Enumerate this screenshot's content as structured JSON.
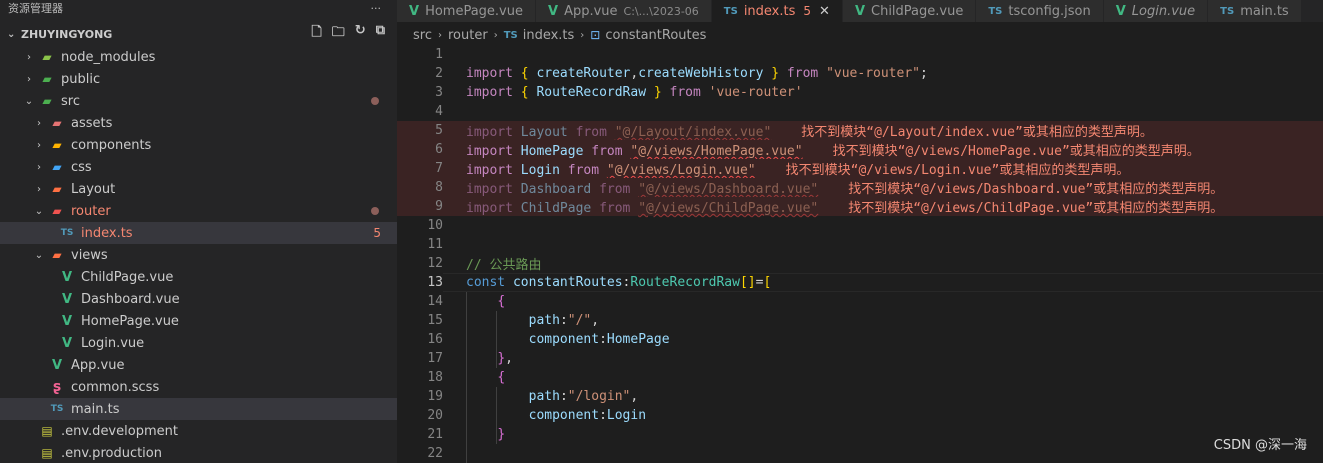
{
  "explorer": {
    "title": "资源管理器",
    "more": "···",
    "root_label": "ZHUYINGYONG",
    "items": [
      {
        "label": "node_modules",
        "icon": "folder-node-icon",
        "color": "#8bc34a",
        "chev": "›",
        "indent": 0
      },
      {
        "label": "public",
        "icon": "folder-public-icon",
        "color": "#4caf50",
        "chev": "›",
        "indent": 0
      },
      {
        "label": "src",
        "icon": "folder-src-icon",
        "color": "#4caf50",
        "chev": "⌄",
        "indent": 0
      },
      {
        "label": "assets",
        "icon": "folder-assets-icon",
        "color": "#e57373",
        "chev": "›",
        "indent": 1
      },
      {
        "label": "components",
        "icon": "folder-components-icon",
        "color": "#ffb300",
        "chev": "›",
        "indent": 1
      },
      {
        "label": "css",
        "icon": "folder-css-icon",
        "color": "#42a5f5",
        "chev": "›",
        "indent": 1
      },
      {
        "label": "Layout",
        "icon": "folder-layout-icon",
        "color": "#ff7043",
        "chev": "›",
        "indent": 1
      },
      {
        "label": "router",
        "icon": "folder-router-icon",
        "color": "#ef5350",
        "chev": "⌄",
        "indent": 1
      },
      {
        "label": "index.ts",
        "icon": "typescript-icon",
        "color": "#519aba",
        "chev": "",
        "indent": 2
      },
      {
        "label": "views",
        "icon": "folder-views-icon",
        "color": "#ff7043",
        "chev": "⌄",
        "indent": 1
      },
      {
        "label": "ChildPage.vue",
        "icon": "vue-icon",
        "color": "#41b883",
        "chev": "",
        "indent": 2
      },
      {
        "label": "Dashboard.vue",
        "icon": "vue-icon",
        "color": "#41b883",
        "chev": "",
        "indent": 2
      },
      {
        "label": "HomePage.vue",
        "icon": "vue-icon",
        "color": "#41b883",
        "chev": "",
        "indent": 2
      },
      {
        "label": "Login.vue",
        "icon": "vue-icon",
        "color": "#41b883",
        "chev": "",
        "indent": 2
      },
      {
        "label": "App.vue",
        "icon": "vue-icon",
        "color": "#41b883",
        "chev": "",
        "indent": 1
      },
      {
        "label": "common.scss",
        "icon": "sass-icon",
        "color": "#f06292",
        "chev": "",
        "indent": 1
      },
      {
        "label": "main.ts",
        "icon": "typescript-icon",
        "color": "#519aba",
        "chev": "",
        "indent": 1
      },
      {
        "label": ".env.development",
        "icon": "env-file-icon",
        "color": "#cbcb41",
        "chev": "",
        "indent": 0
      },
      {
        "label": ".env.production",
        "icon": "env-file-icon",
        "color": "#cbcb41",
        "chev": "",
        "indent": 0
      }
    ],
    "index_badge": "5"
  },
  "tabs": [
    {
      "label": "HomePage.vue",
      "icon_text": "V",
      "icon": "vue-icon",
      "hint": "",
      "num": ""
    },
    {
      "label": "App.vue",
      "icon_text": "V",
      "icon": "vue-icon",
      "hint": "C:\\...\\2023-06",
      "num": ""
    },
    {
      "label": "index.ts",
      "icon_text": "TS",
      "icon": "typescript-icon",
      "hint": "",
      "num": "5"
    },
    {
      "label": "ChildPage.vue",
      "icon_text": "V",
      "icon": "vue-icon",
      "hint": "",
      "num": ""
    },
    {
      "label": "tsconfig.json",
      "icon_text": "TS",
      "icon": "typescript-icon",
      "hint": "",
      "num": ""
    },
    {
      "label": "Login.vue",
      "icon_text": "V",
      "icon": "vue-icon",
      "hint": "",
      "num": ""
    },
    {
      "label": "main.ts",
      "icon_text": "TS",
      "icon": "typescript-icon",
      "hint": "",
      "num": ""
    }
  ],
  "breadcrumb": {
    "src": "src",
    "router": "router",
    "file_icon": "TS",
    "file": "index.ts",
    "symbol": "constantRoutes"
  },
  "editor": {
    "current_line": 13,
    "lines": [
      {
        "n": "1"
      },
      {
        "n": "2",
        "tokens": [
          [
            "kw",
            "import"
          ],
          [
            "pl",
            " "
          ],
          [
            "br3",
            "{"
          ],
          [
            "pl",
            " "
          ],
          [
            "id",
            "createRouter"
          ],
          [
            "pl",
            ","
          ],
          [
            "id",
            "createWebHistory"
          ],
          [
            "pl",
            " "
          ],
          [
            "br3",
            "}"
          ],
          [
            "pl",
            " "
          ],
          [
            "kw",
            "from"
          ],
          [
            "pl",
            " "
          ],
          [
            "str",
            "\"vue-router\""
          ],
          [
            "pl",
            ";"
          ]
        ]
      },
      {
        "n": "3",
        "tokens": [
          [
            "kw",
            "import"
          ],
          [
            "pl",
            " "
          ],
          [
            "br3",
            "{"
          ],
          [
            "pl",
            " "
          ],
          [
            "id",
            "RouteRecordRaw"
          ],
          [
            "pl",
            " "
          ],
          [
            "br3",
            "}"
          ],
          [
            "pl",
            " "
          ],
          [
            "kw",
            "from"
          ],
          [
            "pl",
            " "
          ],
          [
            "str",
            "'vue-router'"
          ]
        ]
      },
      {
        "n": "4"
      },
      {
        "n": "5",
        "err": true,
        "dim": true,
        "tokens": [
          [
            "kw",
            "import"
          ],
          [
            "pl",
            " "
          ],
          [
            "id",
            "Layout"
          ],
          [
            "pl",
            " "
          ],
          [
            "kw",
            "from"
          ],
          [
            "pl",
            " "
          ],
          [
            "sq",
            "\"@/Layout/index.vue\""
          ]
        ],
        "msg": "找不到模块“@/Layout/index.vue”或其相应的类型声明。"
      },
      {
        "n": "6",
        "err": true,
        "tokens": [
          [
            "kw",
            "import"
          ],
          [
            "pl",
            " "
          ],
          [
            "id",
            "HomePage"
          ],
          [
            "pl",
            " "
          ],
          [
            "kw",
            "from"
          ],
          [
            "pl",
            " "
          ],
          [
            "sq",
            "\"@/views/HomePage.vue\""
          ]
        ],
        "msg": "找不到模块“@/views/HomePage.vue”或其相应的类型声明。"
      },
      {
        "n": "7",
        "err": true,
        "tokens": [
          [
            "kw",
            "import"
          ],
          [
            "pl",
            " "
          ],
          [
            "id",
            "Login"
          ],
          [
            "pl",
            " "
          ],
          [
            "kw",
            "from"
          ],
          [
            "pl",
            " "
          ],
          [
            "sq",
            "\"@/views/Login.vue\""
          ]
        ],
        "msg": "找不到模块“@/views/Login.vue”或其相应的类型声明。"
      },
      {
        "n": "8",
        "err": true,
        "dim": true,
        "tokens": [
          [
            "kw",
            "import"
          ],
          [
            "pl",
            " "
          ],
          [
            "id",
            "Dashboard"
          ],
          [
            "pl",
            " "
          ],
          [
            "kw",
            "from"
          ],
          [
            "pl",
            " "
          ],
          [
            "sq",
            "\"@/views/Dashboard.vue\""
          ]
        ],
        "msg": "找不到模块“@/views/Dashboard.vue”或其相应的类型声明。"
      },
      {
        "n": "9",
        "err": true,
        "dim": true,
        "tokens": [
          [
            "kw",
            "import"
          ],
          [
            "pl",
            " "
          ],
          [
            "id",
            "ChildPage"
          ],
          [
            "pl",
            " "
          ],
          [
            "kw",
            "from"
          ],
          [
            "pl",
            " "
          ],
          [
            "sq",
            "\"@/views/ChildPage.vue\""
          ]
        ],
        "msg": "找不到模块“@/views/ChildPage.vue”或其相应的类型声明。"
      },
      {
        "n": "10"
      },
      {
        "n": "11"
      },
      {
        "n": "12",
        "tokens": [
          [
            "cm",
            "// 公共路由"
          ]
        ]
      },
      {
        "n": "13",
        "tokens": [
          [
            "kw2",
            "const"
          ],
          [
            "pl",
            " "
          ],
          [
            "id",
            "constantRoutes"
          ],
          [
            "pl",
            ":"
          ],
          [
            "ty",
            "RouteRecordRaw"
          ],
          [
            "br3",
            "[]"
          ],
          [
            "pl",
            "="
          ],
          [
            "br3",
            "["
          ]
        ]
      },
      {
        "n": "14",
        "tokens": [
          [
            "pl",
            "    "
          ],
          [
            "br",
            "{"
          ]
        ]
      },
      {
        "n": "15",
        "tokens": [
          [
            "pl",
            "        "
          ],
          [
            "id",
            "path"
          ],
          [
            "pl",
            ":"
          ],
          [
            "str",
            "\"/\""
          ],
          [
            "pl",
            ","
          ]
        ]
      },
      {
        "n": "16",
        "tokens": [
          [
            "pl",
            "        "
          ],
          [
            "id",
            "component"
          ],
          [
            "pl",
            ":"
          ],
          [
            "id",
            "HomePage"
          ]
        ]
      },
      {
        "n": "17",
        "tokens": [
          [
            "pl",
            "    "
          ],
          [
            "br",
            "}"
          ],
          [
            "pl",
            ","
          ]
        ]
      },
      {
        "n": "18",
        "tokens": [
          [
            "pl",
            "    "
          ],
          [
            "br",
            "{"
          ]
        ]
      },
      {
        "n": "19",
        "tokens": [
          [
            "pl",
            "        "
          ],
          [
            "id",
            "path"
          ],
          [
            "pl",
            ":"
          ],
          [
            "str",
            "\"/login\""
          ],
          [
            "pl",
            ","
          ]
        ]
      },
      {
        "n": "20",
        "tokens": [
          [
            "pl",
            "        "
          ],
          [
            "id",
            "component"
          ],
          [
            "pl",
            ":"
          ],
          [
            "id",
            "Login"
          ]
        ]
      },
      {
        "n": "21",
        "tokens": [
          [
            "pl",
            "    "
          ],
          [
            "br",
            "}"
          ]
        ]
      },
      {
        "n": "22"
      }
    ]
  },
  "watermark": "CSDN @深一海"
}
